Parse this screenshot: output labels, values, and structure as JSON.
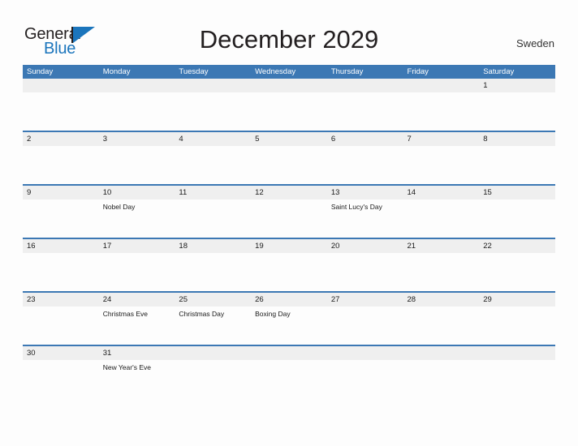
{
  "brand": {
    "name_part1": "General",
    "name_part2": "Blue"
  },
  "header": {
    "title": "December 2029",
    "country": "Sweden"
  },
  "colors": {
    "header_blue": "#3c78b4",
    "logo_blue": "#1b75bc",
    "number_band": "#efefef",
    "page_background": "#fdfdfd"
  },
  "calendar": {
    "weekdays": [
      "Sunday",
      "Monday",
      "Tuesday",
      "Wednesday",
      "Thursday",
      "Friday",
      "Saturday"
    ],
    "weeks": [
      [
        {
          "day": "",
          "event": ""
        },
        {
          "day": "",
          "event": ""
        },
        {
          "day": "",
          "event": ""
        },
        {
          "day": "",
          "event": ""
        },
        {
          "day": "",
          "event": ""
        },
        {
          "day": "",
          "event": ""
        },
        {
          "day": "1",
          "event": ""
        }
      ],
      [
        {
          "day": "2",
          "event": ""
        },
        {
          "day": "3",
          "event": ""
        },
        {
          "day": "4",
          "event": ""
        },
        {
          "day": "5",
          "event": ""
        },
        {
          "day": "6",
          "event": ""
        },
        {
          "day": "7",
          "event": ""
        },
        {
          "day": "8",
          "event": ""
        }
      ],
      [
        {
          "day": "9",
          "event": ""
        },
        {
          "day": "10",
          "event": "Nobel Day"
        },
        {
          "day": "11",
          "event": ""
        },
        {
          "day": "12",
          "event": ""
        },
        {
          "day": "13",
          "event": "Saint Lucy's Day"
        },
        {
          "day": "14",
          "event": ""
        },
        {
          "day": "15",
          "event": ""
        }
      ],
      [
        {
          "day": "16",
          "event": ""
        },
        {
          "day": "17",
          "event": ""
        },
        {
          "day": "18",
          "event": ""
        },
        {
          "day": "19",
          "event": ""
        },
        {
          "day": "20",
          "event": ""
        },
        {
          "day": "21",
          "event": ""
        },
        {
          "day": "22",
          "event": ""
        }
      ],
      [
        {
          "day": "23",
          "event": ""
        },
        {
          "day": "24",
          "event": "Christmas Eve"
        },
        {
          "day": "25",
          "event": "Christmas Day"
        },
        {
          "day": "26",
          "event": "Boxing Day"
        },
        {
          "day": "27",
          "event": ""
        },
        {
          "day": "28",
          "event": ""
        },
        {
          "day": "29",
          "event": ""
        }
      ],
      [
        {
          "day": "30",
          "event": ""
        },
        {
          "day": "31",
          "event": "New Year's Eve"
        },
        {
          "day": "",
          "event": ""
        },
        {
          "day": "",
          "event": ""
        },
        {
          "day": "",
          "event": ""
        },
        {
          "day": "",
          "event": ""
        },
        {
          "day": "",
          "event": ""
        }
      ]
    ]
  }
}
